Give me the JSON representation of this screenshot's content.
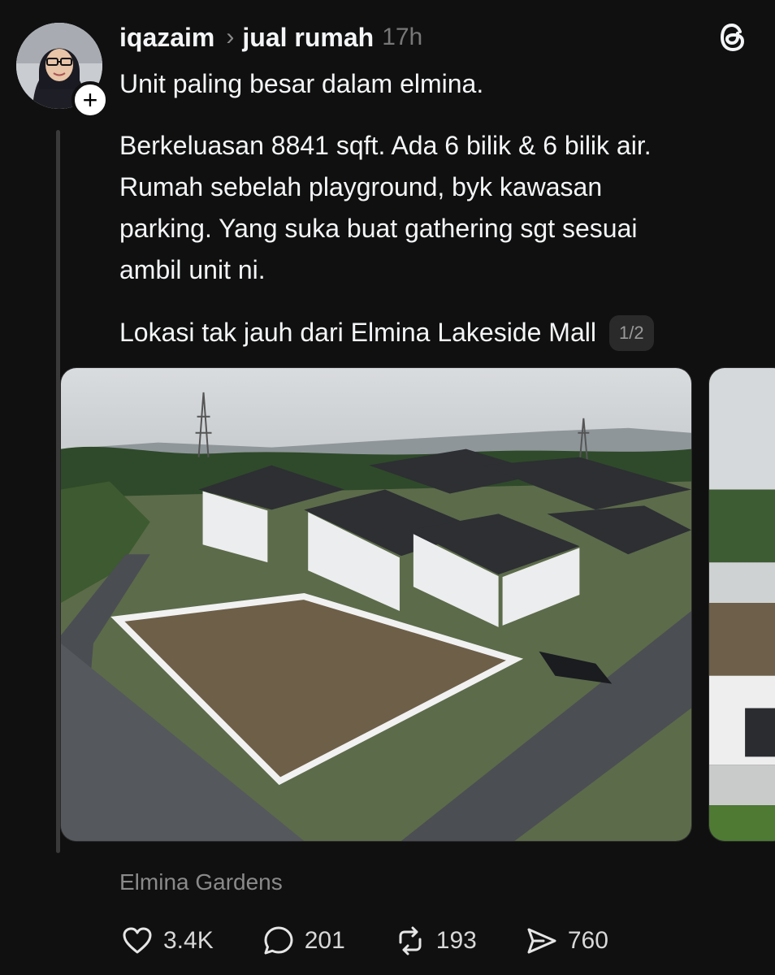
{
  "author": {
    "username": "iqazaim",
    "topic": "jual rumah",
    "time": "17h",
    "follow_label": "+"
  },
  "post": {
    "line1": "Unit paling besar dalam elmina.",
    "para2": [
      "Berkeluasan 8841 sqft. Ada 6 bilik & 6 bilik air.",
      "Rumah sebelah playground, byk kawasan",
      "parking. Yang suka buat gathering sgt sesuai",
      "ambil unit ni."
    ],
    "line3": "Lokasi tak jauh dari Elmina Lakeside Mall",
    "image_counter": "1/2",
    "location": "Elmina Gardens"
  },
  "actions": {
    "like_count": "3.4K",
    "reply_count": "201",
    "repost_count": "193",
    "share_count": "760"
  },
  "icons": {
    "chevron": "›",
    "threads_logo": "threads-logo-icon",
    "like": "heart-icon",
    "reply": "speech-bubble-icon",
    "repost": "repost-arrows-icon",
    "share": "send-icon"
  },
  "colors": {
    "background": "#101010",
    "text": "#f3f5f7",
    "muted": "#8a8a8a",
    "counter_bg": "#2a2a2a"
  }
}
